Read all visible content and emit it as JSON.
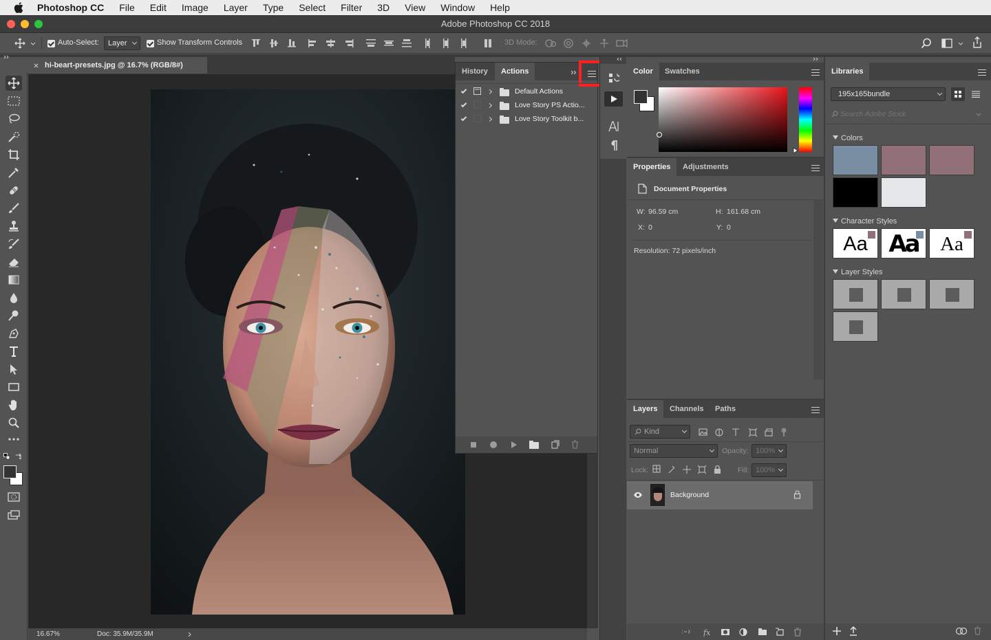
{
  "menubar": {
    "app_name": "Photoshop CC",
    "items": [
      "File",
      "Edit",
      "Image",
      "Layer",
      "Type",
      "Select",
      "Filter",
      "3D",
      "View",
      "Window",
      "Help"
    ]
  },
  "window": {
    "title": "Adobe Photoshop CC 2018"
  },
  "options_bar": {
    "auto_select_label": "Auto-Select:",
    "auto_select_value": "Layer",
    "show_transform_label": "Show Transform Controls",
    "three_d_mode_label": "3D Mode:"
  },
  "document": {
    "tab_title": "hi-beart-presets.jpg @ 16.7% (RGB/8#)",
    "zoom": "16.67%",
    "doc_size": "Doc: 35.9M/35.9M"
  },
  "actions_panel": {
    "tabs": [
      "History",
      "Actions"
    ],
    "active_tab": "Actions",
    "items": [
      "Default Actions",
      "Love Story PS Actio...",
      "Love Story Toolkit b..."
    ]
  },
  "color_panel": {
    "tabs": [
      "Color",
      "Swatches"
    ],
    "active_tab": "Color",
    "hue_color": "#e8141b"
  },
  "properties_panel": {
    "tabs": [
      "Properties",
      "Adjustments"
    ],
    "title": "Document Properties",
    "w_label": "W:",
    "w_value": "96.59 cm",
    "h_label": "H:",
    "h_value": "161.68 cm",
    "x_label": "X:",
    "x_value": "0",
    "y_label": "Y:",
    "y_value": "0",
    "resolution": "Resolution: 72 pixels/inch"
  },
  "layers_panel": {
    "tabs": [
      "Layers",
      "Channels",
      "Paths"
    ],
    "kind_label": "Kind",
    "blend_mode": "Normal",
    "opacity_label": "Opacity:",
    "opacity_value": "100%",
    "lock_label": "Lock:",
    "fill_label": "Fill:",
    "fill_value": "100%",
    "layers": [
      {
        "name": "Background"
      }
    ]
  },
  "libraries_panel": {
    "tab": "Libraries",
    "library_name": "195x165bundle",
    "search_placeholder": "Search Adobe Stock",
    "colors_label": "Colors",
    "colors": [
      "#7a8ea3",
      "#917077",
      "#917077",
      "#000000",
      "#e6e7e8"
    ],
    "character_styles_label": "Character Styles",
    "character_style_sample": "Aa",
    "character_style_corner_colors": [
      "#917077",
      "#7a8ea3",
      "#917077"
    ],
    "layer_styles_label": "Layer Styles"
  }
}
